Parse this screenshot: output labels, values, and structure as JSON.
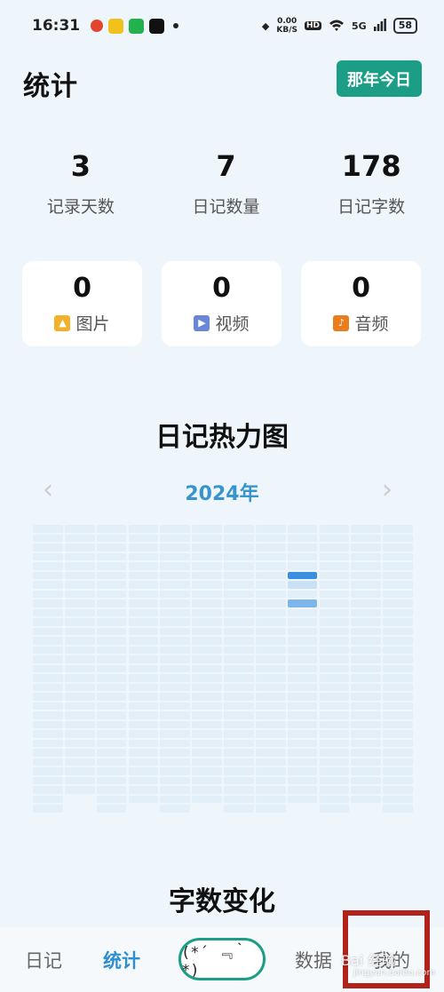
{
  "status_bar": {
    "time": "16:31",
    "speed_value": "0.00",
    "speed_unit": "KB/S",
    "hd": "HD",
    "network": "5G",
    "battery": "58"
  },
  "header": {
    "title": "统计",
    "today_button": "那年今日"
  },
  "stats": [
    {
      "value": "3",
      "label": "记录天数"
    },
    {
      "value": "7",
      "label": "日记数量"
    },
    {
      "value": "178",
      "label": "日记字数"
    }
  ],
  "media": [
    {
      "value": "0",
      "label": "图片",
      "icon": "image-icon"
    },
    {
      "value": "0",
      "label": "视频",
      "icon": "video-icon"
    },
    {
      "value": "0",
      "label": "音频",
      "icon": "audio-icon"
    }
  ],
  "heatmap": {
    "title": "日记热力图",
    "year": "2024年",
    "prev": "‹",
    "next": "›",
    "colors": {
      "empty": "#e2eef8",
      "level1": "#c9e1f5",
      "level2": "#7db6ea",
      "level3": "#3b8fe0"
    }
  },
  "word_chart": {
    "title": "字数变化"
  },
  "bottom_nav": {
    "diary": "日记",
    "stats": "统计",
    "center": "(*´ ﹃｀*)",
    "data": "数据",
    "mine": "我的"
  },
  "watermark": {
    "main": "Bai 经验",
    "sub": "jingyan.baidu.com"
  }
}
